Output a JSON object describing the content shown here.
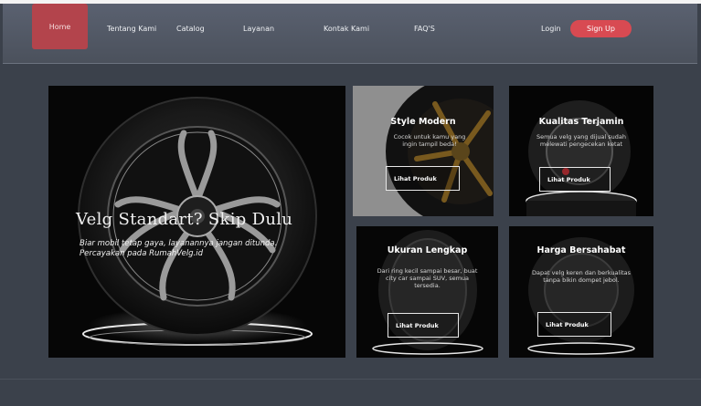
{
  "nav": {
    "home": "Home",
    "links": [
      "Tentang Kami",
      "Catalog",
      "Layanan",
      "Kontak Kami",
      "FAQ'S"
    ],
    "login": "Login",
    "signup": "Sign Up",
    "active_color": "#b3444c",
    "signup_color": "#d84a52"
  },
  "hero": {
    "title": "Velg Standart? Skip Dulu",
    "subtitle": "Biar mobil tetap gaya, layanannya jangan ditunda. Percayakan pada RumahVelg.id"
  },
  "cards": [
    {
      "title": "Style Modern",
      "desc": "Cocok untuk kamu yang ingin tampil beda!",
      "button": "Lihat Produk"
    },
    {
      "title": "Kualitas Terjamin",
      "desc": "Semua velg yang dijual sudah melewati pengecekan ketat",
      "button": "Lihat Produk"
    },
    {
      "title": "Ukuran Lengkap",
      "desc": "Dari ring kecil sampai besar, buat city car sampai SUV, semua tersedia.",
      "button": "Lihat Produk"
    },
    {
      "title": "Harga Bersahabat",
      "desc": "Dapat velg keren dan berkualitas tanpa bikin dompet jebol.",
      "button": "Lihat Produk"
    }
  ]
}
